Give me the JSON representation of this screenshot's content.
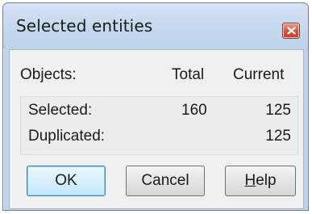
{
  "window": {
    "title": "Selected entities"
  },
  "headers": {
    "objects": "Objects:",
    "total": "Total",
    "current": "Current"
  },
  "rows": [
    {
      "label": "Selected:",
      "total": "160",
      "current": "125"
    },
    {
      "label": "Duplicated:",
      "total": "",
      "current": "125"
    }
  ],
  "buttons": {
    "ok": "OK",
    "cancel": "Cancel",
    "help_mnemonic": "H",
    "help_rest": "elp"
  },
  "icons": {
    "close": "close-icon"
  },
  "colors": {
    "title_bar": "#c4d7ee",
    "close_button": "#d0533c",
    "default_button_border": "#3c7fb1",
    "client_background": "#f0f0f0"
  }
}
